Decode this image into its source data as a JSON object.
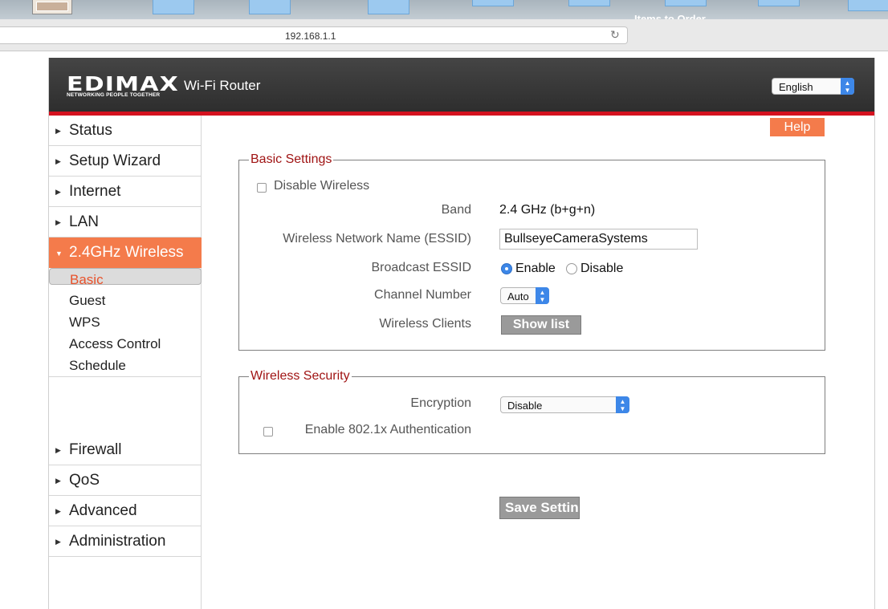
{
  "browser": {
    "url": "192.168.1.1",
    "desktop_label": "Items to Order"
  },
  "header": {
    "logo": "EDIMAX",
    "tagline": "NETWORKING PEOPLE TOGETHER",
    "product": "Wi-Fi Router",
    "language": "English"
  },
  "sidebar": {
    "items": [
      {
        "label": "Status"
      },
      {
        "label": "Setup Wizard"
      },
      {
        "label": "Internet"
      },
      {
        "label": "LAN"
      },
      {
        "label": "2.4GHz Wireless"
      },
      {
        "label": "Firewall"
      },
      {
        "label": "QoS"
      },
      {
        "label": "Advanced"
      },
      {
        "label": "Administration"
      }
    ],
    "sub_items": [
      {
        "label": "Basic"
      },
      {
        "label": "Guest"
      },
      {
        "label": "WPS"
      },
      {
        "label": "Access Control"
      },
      {
        "label": "Schedule"
      }
    ],
    "active": "2.4GHz Wireless",
    "selected_sub": "Basic"
  },
  "main": {
    "help_label": "Help",
    "basic": {
      "legend": "Basic Settings",
      "disable_wireless_label": "Disable  Wireless",
      "disable_wireless_checked": false,
      "band_label": "Band",
      "band_value": "2.4 GHz (b+g+n)",
      "essid_label": "Wireless Network Name  (ESSID)",
      "essid_value": "BullseyeCameraSystems",
      "broadcast_label": "Broadcast ESSID",
      "broadcast_enable": "Enable",
      "broadcast_disable": "Disable",
      "broadcast_selected": "Enable",
      "channel_label": "Channel Number",
      "channel_value": "Auto",
      "clients_label": "Wireless Clients",
      "show_list_label": "Show list"
    },
    "security": {
      "legend": "Wireless  Security",
      "encryption_label": "Encryption",
      "encryption_value": "Disable",
      "auth_label": "Enable 802.1x Authentication",
      "auth_checked": false
    },
    "save_label": "Save Settings"
  },
  "colors": {
    "accent": "#f47b4b",
    "brand_red": "#d4121f",
    "legend": "#a01414",
    "select_blue": "#3d87e8"
  }
}
